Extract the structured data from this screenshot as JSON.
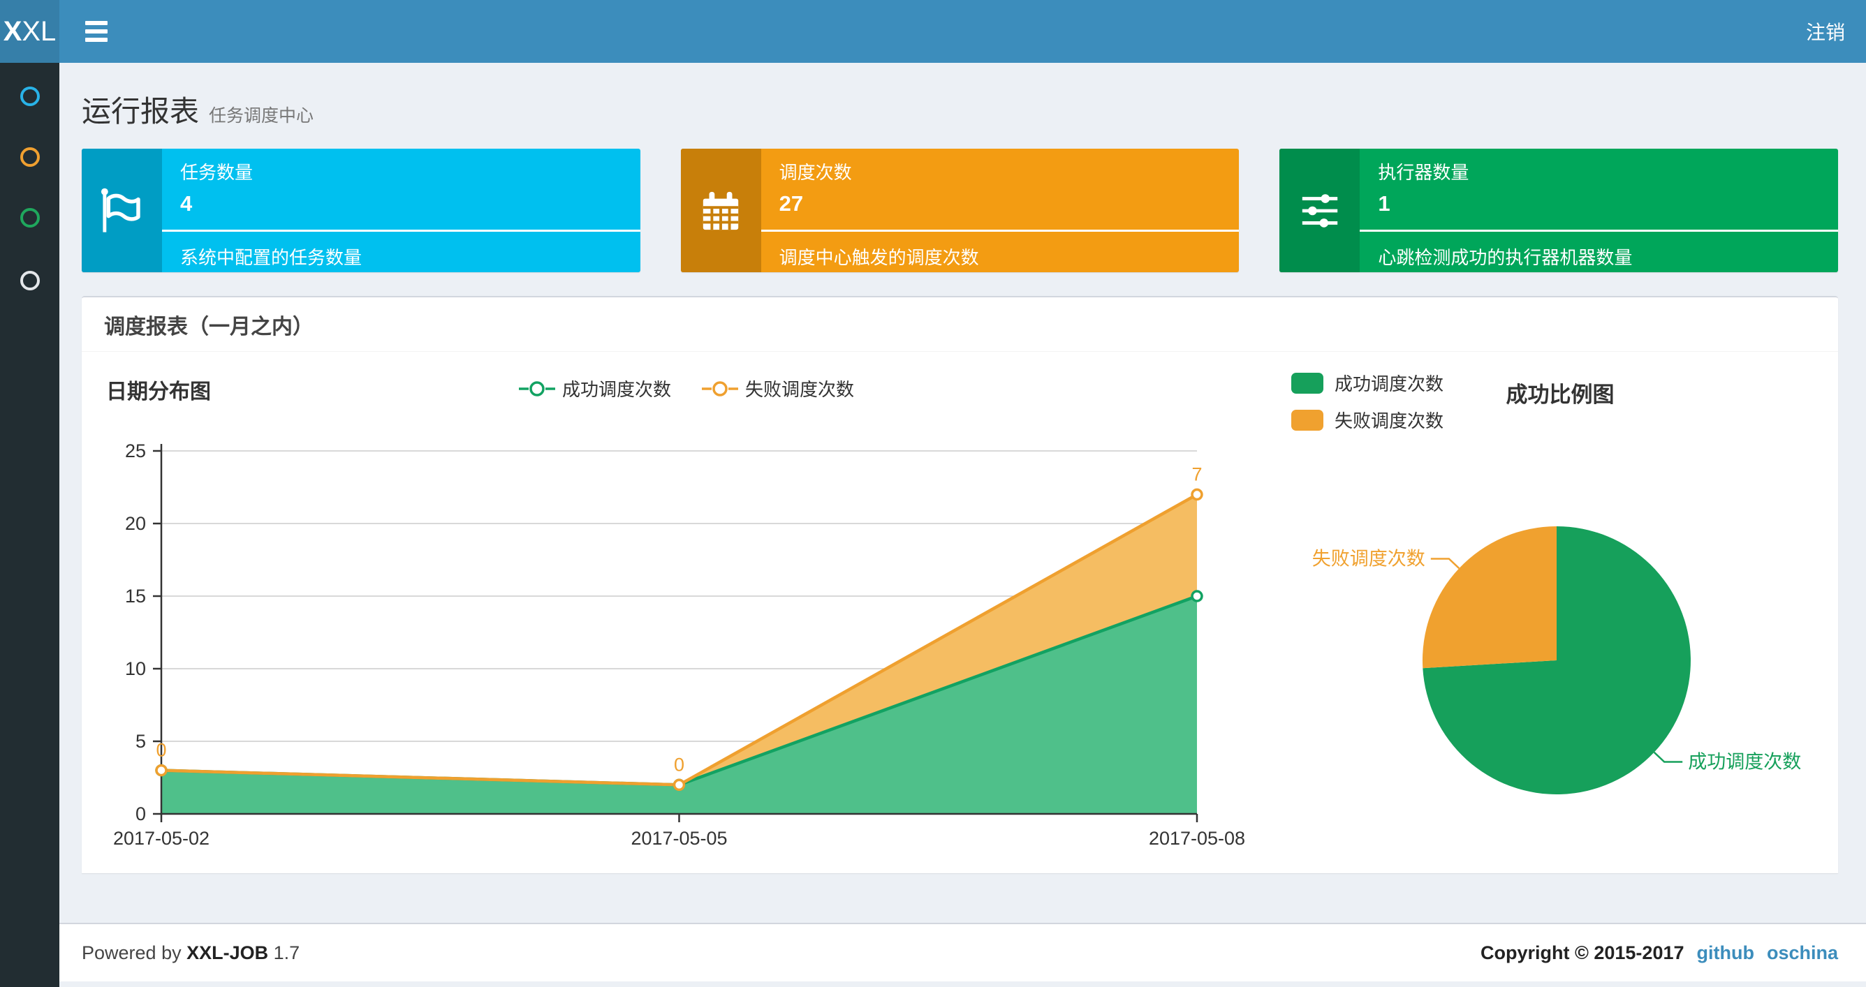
{
  "navbar": {
    "logo_bold": "X",
    "logo_light": "XL",
    "logout_label": "注销"
  },
  "sidebar": {
    "items": [
      {
        "name": "menu-dot-info",
        "color": "#29b3e8"
      },
      {
        "name": "menu-dot-warning",
        "color": "#f0a030"
      },
      {
        "name": "menu-dot-success",
        "color": "#1fa75d"
      },
      {
        "name": "menu-dot-default",
        "color": "#e4e7ea"
      }
    ]
  },
  "page_header": {
    "title": "运行报表",
    "subtitle": "任务调度中心"
  },
  "stat_cards": [
    {
      "title": "任务数量",
      "value": "4",
      "desc": "系统中配置的任务数量",
      "color": "#00c0ef",
      "icon_bg": "#009dc4",
      "icon": "flag-icon"
    },
    {
      "title": "调度次数",
      "value": "27",
      "desc": "调度中心触发的调度次数",
      "color": "#f39c12",
      "icon_bg": "#c87f0a",
      "icon": "calendar-icon"
    },
    {
      "title": "执行器数量",
      "value": "1",
      "desc": "心跳检测成功的执行器机器数量",
      "color": "#00a65a",
      "icon_bg": "#008d4c",
      "icon": "sliders-icon"
    }
  ],
  "panel": {
    "title": "调度报表（一月之内）"
  },
  "chart_data": [
    {
      "type": "area",
      "title": "日期分布图",
      "categories": [
        "2017-05-02",
        "2017-05-05",
        "2017-05-08"
      ],
      "stacked": true,
      "series": [
        {
          "name": "成功调度次数",
          "values": [
            3,
            2,
            15
          ],
          "color": "#12a262",
          "fill": "#4fc08a"
        },
        {
          "name": "失败调度次数",
          "values": [
            0,
            0,
            7
          ],
          "color": "#efa02f",
          "fill": "#f5bd62",
          "labels": [
            "0",
            "0",
            "7"
          ],
          "stacked_totals": [
            3,
            2,
            22
          ]
        }
      ],
      "xlabel": "",
      "ylabel": "",
      "ylim": [
        0,
        25
      ],
      "yticks": [
        0,
        5,
        10,
        15,
        20,
        25
      ],
      "grid": true,
      "legend_position": "top"
    },
    {
      "type": "pie",
      "title": "成功比例图",
      "slices": [
        {
          "label": "成功调度次数",
          "value": 20,
          "color": "#16a05b"
        },
        {
          "label": "失败调度次数",
          "value": 7,
          "color": "#f0a12f"
        }
      ],
      "legend": [
        "成功调度次数",
        "失败调度次数"
      ],
      "legend_position": "top-left",
      "start_angle_deg": -90,
      "clockwise": true
    }
  ],
  "footer": {
    "powered_prefix": "Powered by",
    "product": "XXL-JOB",
    "version": "1.7",
    "copyright": "Copyright © 2015-2017",
    "links": [
      {
        "label": "github"
      },
      {
        "label": "oschina"
      }
    ]
  }
}
